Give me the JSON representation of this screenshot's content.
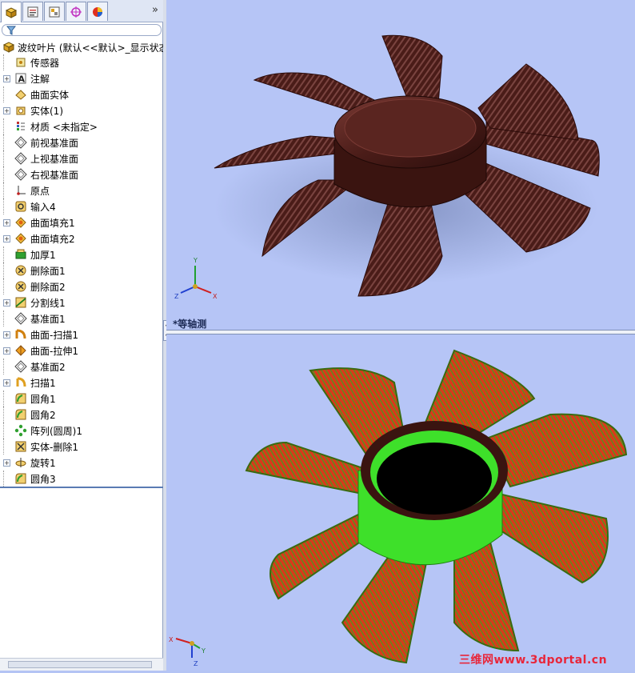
{
  "sidebar": {
    "tabs": [
      {
        "icon": "feature-manager-icon"
      },
      {
        "icon": "property-manager-icon"
      },
      {
        "icon": "configuration-manager-icon"
      },
      {
        "icon": "dimxpert-icon"
      },
      {
        "icon": "display-manager-icon"
      }
    ],
    "expand_label": "»",
    "root_label": "波纹叶片  (默认<<默认>_显示状态",
    "items": [
      {
        "label": "传感器",
        "icon": "sensor-icon",
        "expandable": false
      },
      {
        "label": "注解",
        "icon": "annotations-icon",
        "expandable": true
      },
      {
        "label": "曲面实体",
        "icon": "surface-bodies-icon",
        "expandable": false
      },
      {
        "label": "实体(1)",
        "icon": "solid-bodies-icon",
        "expandable": true
      },
      {
        "label": "材质 <未指定>",
        "icon": "material-icon",
        "expandable": false
      },
      {
        "label": "前视基准面",
        "icon": "plane-icon",
        "expandable": false
      },
      {
        "label": "上视基准面",
        "icon": "plane-icon",
        "expandable": false
      },
      {
        "label": "右视基准面",
        "icon": "plane-icon",
        "expandable": false
      },
      {
        "label": "原点",
        "icon": "origin-icon",
        "expandable": false
      },
      {
        "label": "输入4",
        "icon": "imported-icon",
        "expandable": false
      },
      {
        "label": "曲面填充1",
        "icon": "surface-fill-icon",
        "expandable": true
      },
      {
        "label": "曲面填充2",
        "icon": "surface-fill-icon",
        "expandable": true
      },
      {
        "label": "加厚1",
        "icon": "thicken-icon",
        "expandable": false
      },
      {
        "label": "删除面1",
        "icon": "delete-face-icon",
        "expandable": false
      },
      {
        "label": "删除面2",
        "icon": "delete-face-icon",
        "expandable": false
      },
      {
        "label": "分割线1",
        "icon": "split-line-icon",
        "expandable": true
      },
      {
        "label": "基准面1",
        "icon": "plane-icon",
        "expandable": false
      },
      {
        "label": "曲面-扫描1",
        "icon": "surface-sweep-icon",
        "expandable": true
      },
      {
        "label": "曲面-拉伸1",
        "icon": "surface-extrude-icon",
        "expandable": true
      },
      {
        "label": "基准面2",
        "icon": "plane-icon",
        "expandable": false
      },
      {
        "label": "扫描1",
        "icon": "sweep-icon",
        "expandable": true
      },
      {
        "label": "圆角1",
        "icon": "fillet-icon",
        "expandable": false
      },
      {
        "label": "圆角2",
        "icon": "fillet-icon",
        "expandable": false
      },
      {
        "label": "阵列(圆周)1",
        "icon": "circular-pattern-icon",
        "expandable": false
      },
      {
        "label": "实体-删除1",
        "icon": "delete-body-icon",
        "expandable": false
      },
      {
        "label": "旋转1",
        "icon": "revolve-icon",
        "expandable": true
      },
      {
        "label": "圆角3",
        "icon": "fillet-icon",
        "expandable": false
      }
    ]
  },
  "viewport_top": {
    "view_label": "*等轴测",
    "triad": {
      "x": "X",
      "y": "Y",
      "z": "Z"
    },
    "model_color": "#4a1c18"
  },
  "viewport_bottom": {
    "triad": {
      "x": "X",
      "y": "Y",
      "z": "Z"
    },
    "model_colors": {
      "blade": "#d83a1a",
      "hub": "#3ee02a",
      "hole": "#000000"
    }
  },
  "watermark": "三维网www.3dportal.cn"
}
